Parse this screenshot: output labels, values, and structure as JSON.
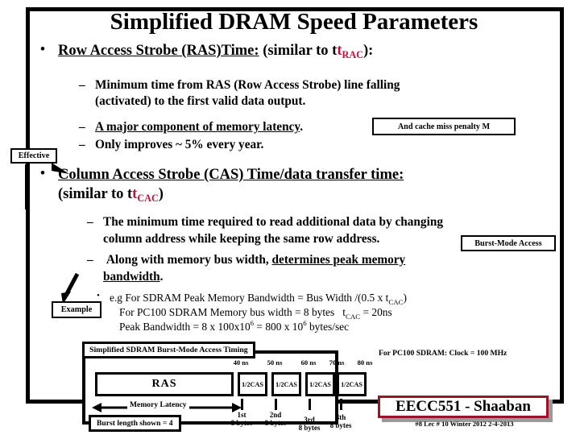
{
  "slide": {
    "title": "Simplified DRAM Speed Parameters",
    "bullets": [
      {
        "lead_underlined": "Row Access Strobe (RAS)Time:",
        "tail_prefix": " (similar to t",
        "tail_sub": "RAC",
        "tail_suffix": "):"
      },
      {
        "lead_underlined": "Column Access Strobe (CAS) Time/data transfer time:",
        "line2_prefix": "(similar to t",
        "line2_sub": "CAC",
        "line2_suffix": ")"
      }
    ],
    "sub_bullets_ras": [
      "Minimum time from RAS (Row Access Strobe) line falling",
      "(activated) to the first valid data output.",
      "A major component of memory latency.",
      "Only improves ~ 5% every year."
    ],
    "sub_bullets_cas": [
      "The minimum time required to read additional data by changing",
      "column address while keeping the same row address.",
      " Along with memory bus width, determines peak memory",
      "bandwidth."
    ],
    "underlined_phrases": {
      "major_component": "A major component of memory latency",
      "determines_peak": "determines peak memory bandwidth"
    },
    "example_lines": {
      "line1_a": "e.g For SDRAM Peak Memory Bandwidth = Bus Width /(0.5 x t",
      "line1_sub": "CAC",
      "line1_b": ")",
      "line2_a": "For PC100 SDRAM Memory bus width = 8 bytes",
      "line2_b": "t",
      "line2_sub": "CAC",
      "line2_c": " = 20ns",
      "line3_a": "Peak Bandwidth =  8 x 100x10",
      "line3_sup1": "6",
      "line3_b": " =  800 x 10",
      "line3_sup2": "6",
      "line3_c": " bytes/sec"
    },
    "callouts": {
      "effective": "Effective",
      "cache_miss": "And cache miss penalty M",
      "burst_mode": "Burst-Mode Access",
      "example": "Example"
    },
    "clock_note": "For PC100 SDRAM: Clock = 100 MHz"
  },
  "timing_diagram": {
    "header": "Simplified SDRAM Burst-Mode Access Timing",
    "ras_label": "RAS",
    "cas_label": "1/2CAS",
    "cas_blocks": [
      "1/2CAS",
      "1/2CAS",
      "1/2CAS",
      "1/2CAS"
    ],
    "ns_labels": [
      "40 ns",
      "50 ns",
      "60 ns",
      "70 ns",
      "80 ns"
    ],
    "order_labels": [
      "1st\n8 bytes",
      "2nd\n8 bytes",
      "3rd\n8 bytes",
      "4th\n8 bytes"
    ],
    "order_ordinals": [
      "1st",
      "2nd",
      "3rd",
      "4th"
    ],
    "order_sizes": [
      "8 bytes",
      "8 bytes",
      "8 bytes",
      "8 bytes"
    ],
    "latency_label": "Memory Latency",
    "burst_length": "Burst length shown = 4"
  },
  "footer": {
    "banner": "EECC551 - Shaaban",
    "note": "#8   Lec # 10 Winter 2012  2-4-2013"
  },
  "colors": {
    "accent_red": "#C1123C",
    "banner_border": "#9C1228",
    "banner_shadow": "#9a9a9a",
    "frame": "#000000"
  }
}
